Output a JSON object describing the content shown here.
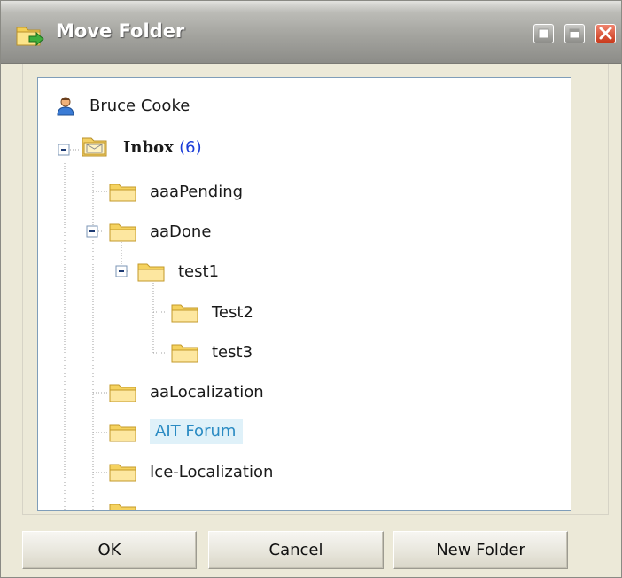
{
  "window": {
    "title": "Move Folder",
    "icon": "folder-move-icon",
    "controls": [
      "minimize-icon",
      "maximize-icon",
      "close-icon"
    ]
  },
  "tree": {
    "root_user": "Bruce Cooke",
    "items": [
      {
        "label": "Inbox",
        "count": "(6)",
        "bold": true,
        "expanded": true,
        "icon": "inbox-folder-icon"
      },
      {
        "label": "aaaPending",
        "level": 1
      },
      {
        "label": "aaDone",
        "level": 1,
        "expanded": true
      },
      {
        "label": "test1",
        "level": 2,
        "expanded": true
      },
      {
        "label": "Test2",
        "level": 3
      },
      {
        "label": "test3",
        "level": 3
      },
      {
        "label": "aaLocalization",
        "level": 1
      },
      {
        "label": "AIT Forum",
        "level": 1,
        "selected": true
      },
      {
        "label": "Ice-Localization",
        "level": 1
      }
    ]
  },
  "buttons": {
    "ok": "OK",
    "cancel": "Cancel",
    "new_folder": "New Folder"
  },
  "colors": {
    "selection_bg": "#dff1f9",
    "selection_text": "#2a8bc3",
    "count_text": "#1a3cd8",
    "folder_yellow": "#f9d96a"
  }
}
